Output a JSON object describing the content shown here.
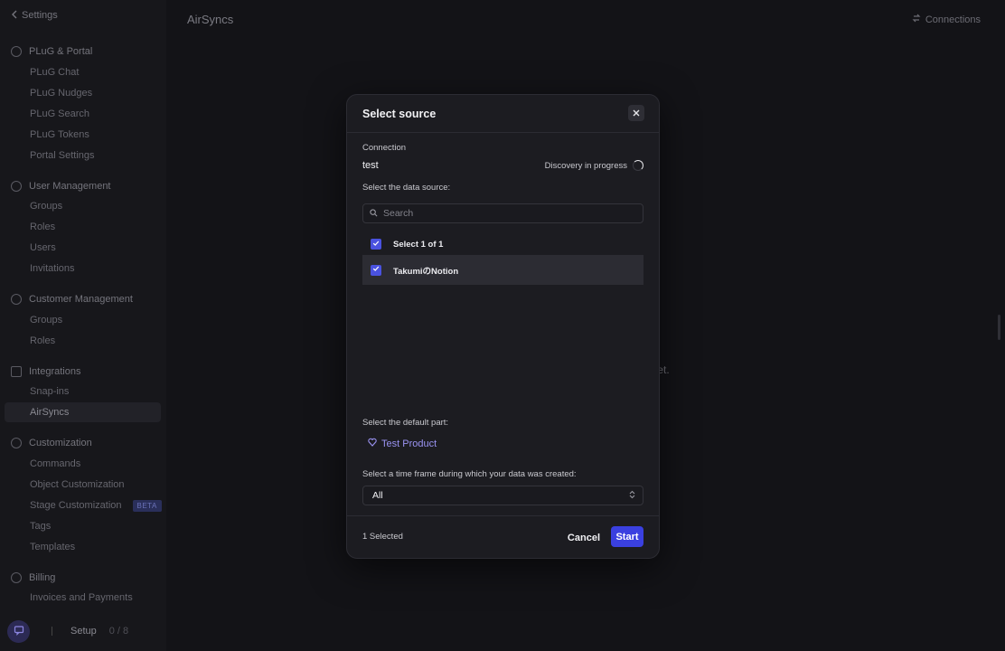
{
  "app": {
    "back_label": "Settings",
    "page_title": "AirSyncs",
    "connections_label": "Connections",
    "empty_text": "y yet."
  },
  "sidebar": {
    "groups": [
      {
        "title": "PLuG & Portal",
        "icon": "globe-icon",
        "items": [
          "PLuG Chat",
          "PLuG Nudges",
          "PLuG Search",
          "PLuG Tokens",
          "Portal Settings"
        ]
      },
      {
        "title": "User Management",
        "icon": "user-circle-icon",
        "items": [
          "Groups",
          "Roles",
          "Users",
          "Invitations"
        ]
      },
      {
        "title": "Customer Management",
        "icon": "customers-icon",
        "items": [
          "Groups",
          "Roles"
        ]
      },
      {
        "title": "Integrations",
        "icon": "integrations-icon",
        "items": [
          "Snap-ins",
          "AirSyncs"
        ]
      },
      {
        "title": "Customization",
        "icon": "customization-icon",
        "items": [
          "Commands",
          "Object Customization",
          "Stage Customization",
          "Tags",
          "Templates"
        ]
      },
      {
        "title": "Billing",
        "icon": "billing-icon",
        "items": [
          "Invoices and Payments"
        ]
      }
    ],
    "active_item": "AirSyncs",
    "beta_label": "BETA",
    "setup_label": "Setup",
    "setup_count": "0 / 8"
  },
  "modal": {
    "title": "Select source",
    "connection_label": "Connection",
    "connection_name": "test",
    "discovery_status": "Discovery in progress",
    "data_source_label": "Select the data source:",
    "search_placeholder": "Search",
    "select_all_label": "Select 1 of 1",
    "source_item": "TakumiのNotion",
    "default_part_label": "Select the default part:",
    "default_part_value": "Test Product",
    "timeframe_label": "Select a time frame during which your data was created:",
    "timeframe_value": "All",
    "selected_count": "1 Selected",
    "cancel_label": "Cancel",
    "start_label": "Start"
  },
  "colors": {
    "accent": "#3a40e0",
    "part_chip": "#9a93f2"
  }
}
